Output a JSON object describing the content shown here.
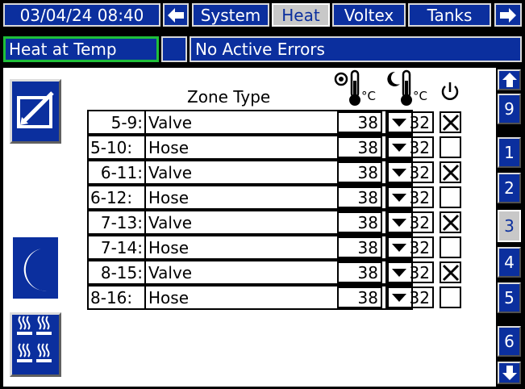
{
  "header": {
    "datetime": "03/04/24 08:40",
    "tabs": [
      {
        "label": "System",
        "active": false
      },
      {
        "label": "Heat",
        "active": true
      },
      {
        "label": "Voltex",
        "active": false
      },
      {
        "label": "Tanks",
        "active": false
      }
    ]
  },
  "status": {
    "state": "Heat at Temp",
    "errors": "No Active Errors"
  },
  "table": {
    "zone_type_header": "Zone Type",
    "setpoint_unit": "°C",
    "setback_unit": "°C",
    "rows": [
      {
        "zone": "5-9:",
        "type": "Valve",
        "setpoint": "38",
        "setback": "32",
        "enabled": true
      },
      {
        "zone": "5-10:",
        "type": "Hose",
        "setpoint": "38",
        "setback": "32",
        "enabled": false
      },
      {
        "zone": "6-11:",
        "type": "Valve",
        "setpoint": "38",
        "setback": "32",
        "enabled": true
      },
      {
        "zone": "6-12:",
        "type": "Hose",
        "setpoint": "38",
        "setback": "32",
        "enabled": false
      },
      {
        "zone": "7-13:",
        "type": "Valve",
        "setpoint": "38",
        "setback": "32",
        "enabled": true
      },
      {
        "zone": "7-14:",
        "type": "Hose",
        "setpoint": "38",
        "setback": "32",
        "enabled": false
      },
      {
        "zone": "8-15:",
        "type": "Valve",
        "setpoint": "38",
        "setback": "32",
        "enabled": true
      },
      {
        "zone": "8-16:",
        "type": "Hose",
        "setpoint": "38",
        "setback": "32",
        "enabled": false
      }
    ]
  },
  "pages": {
    "items": [
      "9",
      "1",
      "2",
      "3",
      "4",
      "5",
      "6"
    ],
    "selected": "3"
  },
  "icons": {
    "edit": "edit-icon",
    "setback": "moon-setback-icon",
    "heat_zones": "heat-zones-icon",
    "prev_tab": "arrow-left-icon",
    "next_tab": "arrow-right-icon",
    "scroll_up": "arrow-up-icon",
    "scroll_down": "arrow-down-icon",
    "power": "power-icon"
  },
  "colors": {
    "navy": "#0b2f9e",
    "status_border": "#1fbf3a",
    "screen_bg": "#ffffff",
    "frame": "#000000"
  }
}
